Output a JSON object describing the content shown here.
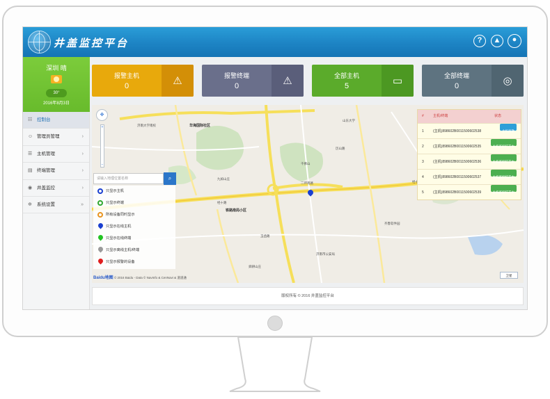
{
  "header": {
    "brand": "井盖监控平台",
    "icons": [
      "question-icon",
      "warning-icon",
      "user-icon"
    ],
    "color": "#1d84c4"
  },
  "sidebar": {
    "weather": {
      "city": "深圳 晴",
      "temp": "30°",
      "date": "2016年8月3日"
    },
    "items": [
      {
        "label": "控制台",
        "icon": "dashboard-icon",
        "arrow": ""
      },
      {
        "label": "管理员管理",
        "icon": "admin-icon",
        "arrow": "›"
      },
      {
        "label": "主机管理",
        "icon": "host-icon",
        "arrow": "›"
      },
      {
        "label": "终端管理",
        "icon": "terminal-icon",
        "arrow": "›"
      },
      {
        "label": "井盖监控",
        "icon": "monitor-icon",
        "arrow": "›"
      },
      {
        "label": "系统设置",
        "icon": "gear-icon",
        "arrow": "»"
      }
    ]
  },
  "cards": [
    {
      "title": "报警主机",
      "value": "0",
      "color": "#e8a90c",
      "icon": "alarm-host-icon"
    },
    {
      "title": "报警终端",
      "value": "0",
      "color": "#6a6f8b",
      "icon": "alarm-terminal-icon"
    },
    {
      "title": "全部主机",
      "value": "5",
      "color": "#5bab2b",
      "icon": "all-host-icon"
    },
    {
      "title": "全部终端",
      "value": "0",
      "color": "#5e7380",
      "icon": "all-terminal-icon"
    }
  ],
  "map": {
    "search_placeholder": "请输入地理位置名称",
    "legend": [
      {
        "label": "只显示主机",
        "color": "#1a3fd0",
        "shape": "target"
      },
      {
        "label": "只显示终端",
        "color": "#2fa82f",
        "shape": "target"
      },
      {
        "label": "所有设备同时显示",
        "color": "#e89420",
        "shape": "target"
      },
      {
        "label": "只显示在线主机",
        "color": "#1a3fd0",
        "shape": "pin"
      },
      {
        "label": "只显示在线终端",
        "color": "#22c322",
        "shape": "pin"
      },
      {
        "label": "只显示离线主机/终端",
        "color": "#9a9a9a",
        "shape": "pin"
      },
      {
        "label": "只显示报警的设备",
        "color": "#e01e1e",
        "shape": "pin"
      }
    ],
    "labels": {
      "district1": "华海国际社区",
      "district2": "铁路南局小区",
      "l1": "二环南路",
      "l2": "经十路",
      "l3": "济南大学南校",
      "l4": "九如山庄",
      "l5": "玉函路",
      "l6": "千佛山",
      "l7": "山东大学",
      "l8": "齐鲁软件园",
      "l9": "经十东路",
      "l10": "历山路",
      "l11": "济南市公安局",
      "l12": "舜耕山庄"
    },
    "footer": "© 2016 Baidu - Data © NavInfo & CenNavi & 道道通",
    "baidu": "Baidu地图",
    "toggle": "卫星"
  },
  "table": {
    "headers": [
      "#",
      "主机/终端",
      "状态"
    ],
    "rows": [
      {
        "no": "1",
        "name": "(主机)898602B0011500602538",
        "status": "主机离散",
        "color": "#2d9fd8"
      },
      {
        "no": "2",
        "name": "(主机)898602B0011500602535",
        "status": "主机监控打开中",
        "color": "#4caf50"
      },
      {
        "no": "3",
        "name": "(主机)898602B0011500602536",
        "status": "主机监控打开中",
        "color": "#4caf50"
      },
      {
        "no": "4",
        "name": "(主机)898602B0011500602537",
        "status": "主机监控打开中",
        "color": "#4caf50"
      },
      {
        "no": "5",
        "name": "(主机)898602B0011500602539",
        "status": "主机监控打开中",
        "color": "#4caf50"
      }
    ]
  },
  "footer": "版权所有 © 2016 井盖监控平台"
}
